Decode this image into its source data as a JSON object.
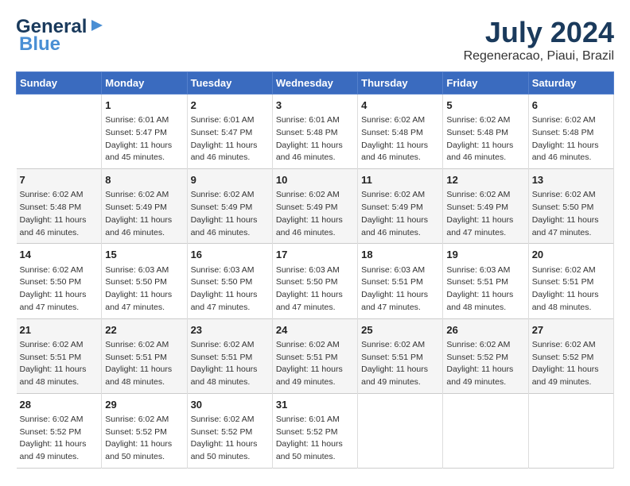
{
  "header": {
    "logo_line1": "General",
    "logo_line2": "Blue",
    "month": "July 2024",
    "location": "Regeneracao, Piaui, Brazil"
  },
  "days_of_week": [
    "Sunday",
    "Monday",
    "Tuesday",
    "Wednesday",
    "Thursday",
    "Friday",
    "Saturday"
  ],
  "weeks": [
    [
      {
        "day": "",
        "info": ""
      },
      {
        "day": "1",
        "info": "Sunrise: 6:01 AM\nSunset: 5:47 PM\nDaylight: 11 hours\nand 45 minutes."
      },
      {
        "day": "2",
        "info": "Sunrise: 6:01 AM\nSunset: 5:47 PM\nDaylight: 11 hours\nand 46 minutes."
      },
      {
        "day": "3",
        "info": "Sunrise: 6:01 AM\nSunset: 5:48 PM\nDaylight: 11 hours\nand 46 minutes."
      },
      {
        "day": "4",
        "info": "Sunrise: 6:02 AM\nSunset: 5:48 PM\nDaylight: 11 hours\nand 46 minutes."
      },
      {
        "day": "5",
        "info": "Sunrise: 6:02 AM\nSunset: 5:48 PM\nDaylight: 11 hours\nand 46 minutes."
      },
      {
        "day": "6",
        "info": "Sunrise: 6:02 AM\nSunset: 5:48 PM\nDaylight: 11 hours\nand 46 minutes."
      }
    ],
    [
      {
        "day": "7",
        "info": "Sunrise: 6:02 AM\nSunset: 5:48 PM\nDaylight: 11 hours\nand 46 minutes."
      },
      {
        "day": "8",
        "info": "Sunrise: 6:02 AM\nSunset: 5:49 PM\nDaylight: 11 hours\nand 46 minutes."
      },
      {
        "day": "9",
        "info": "Sunrise: 6:02 AM\nSunset: 5:49 PM\nDaylight: 11 hours\nand 46 minutes."
      },
      {
        "day": "10",
        "info": "Sunrise: 6:02 AM\nSunset: 5:49 PM\nDaylight: 11 hours\nand 46 minutes."
      },
      {
        "day": "11",
        "info": "Sunrise: 6:02 AM\nSunset: 5:49 PM\nDaylight: 11 hours\nand 46 minutes."
      },
      {
        "day": "12",
        "info": "Sunrise: 6:02 AM\nSunset: 5:49 PM\nDaylight: 11 hours\nand 47 minutes."
      },
      {
        "day": "13",
        "info": "Sunrise: 6:02 AM\nSunset: 5:50 PM\nDaylight: 11 hours\nand 47 minutes."
      }
    ],
    [
      {
        "day": "14",
        "info": "Sunrise: 6:02 AM\nSunset: 5:50 PM\nDaylight: 11 hours\nand 47 minutes."
      },
      {
        "day": "15",
        "info": "Sunrise: 6:03 AM\nSunset: 5:50 PM\nDaylight: 11 hours\nand 47 minutes."
      },
      {
        "day": "16",
        "info": "Sunrise: 6:03 AM\nSunset: 5:50 PM\nDaylight: 11 hours\nand 47 minutes."
      },
      {
        "day": "17",
        "info": "Sunrise: 6:03 AM\nSunset: 5:50 PM\nDaylight: 11 hours\nand 47 minutes."
      },
      {
        "day": "18",
        "info": "Sunrise: 6:03 AM\nSunset: 5:51 PM\nDaylight: 11 hours\nand 47 minutes."
      },
      {
        "day": "19",
        "info": "Sunrise: 6:03 AM\nSunset: 5:51 PM\nDaylight: 11 hours\nand 48 minutes."
      },
      {
        "day": "20",
        "info": "Sunrise: 6:02 AM\nSunset: 5:51 PM\nDaylight: 11 hours\nand 48 minutes."
      }
    ],
    [
      {
        "day": "21",
        "info": "Sunrise: 6:02 AM\nSunset: 5:51 PM\nDaylight: 11 hours\nand 48 minutes."
      },
      {
        "day": "22",
        "info": "Sunrise: 6:02 AM\nSunset: 5:51 PM\nDaylight: 11 hours\nand 48 minutes."
      },
      {
        "day": "23",
        "info": "Sunrise: 6:02 AM\nSunset: 5:51 PM\nDaylight: 11 hours\nand 48 minutes."
      },
      {
        "day": "24",
        "info": "Sunrise: 6:02 AM\nSunset: 5:51 PM\nDaylight: 11 hours\nand 49 minutes."
      },
      {
        "day": "25",
        "info": "Sunrise: 6:02 AM\nSunset: 5:51 PM\nDaylight: 11 hours\nand 49 minutes."
      },
      {
        "day": "26",
        "info": "Sunrise: 6:02 AM\nSunset: 5:52 PM\nDaylight: 11 hours\nand 49 minutes."
      },
      {
        "day": "27",
        "info": "Sunrise: 6:02 AM\nSunset: 5:52 PM\nDaylight: 11 hours\nand 49 minutes."
      }
    ],
    [
      {
        "day": "28",
        "info": "Sunrise: 6:02 AM\nSunset: 5:52 PM\nDaylight: 11 hours\nand 49 minutes."
      },
      {
        "day": "29",
        "info": "Sunrise: 6:02 AM\nSunset: 5:52 PM\nDaylight: 11 hours\nand 50 minutes."
      },
      {
        "day": "30",
        "info": "Sunrise: 6:02 AM\nSunset: 5:52 PM\nDaylight: 11 hours\nand 50 minutes."
      },
      {
        "day": "31",
        "info": "Sunrise: 6:01 AM\nSunset: 5:52 PM\nDaylight: 11 hours\nand 50 minutes."
      },
      {
        "day": "",
        "info": ""
      },
      {
        "day": "",
        "info": ""
      },
      {
        "day": "",
        "info": ""
      }
    ]
  ]
}
